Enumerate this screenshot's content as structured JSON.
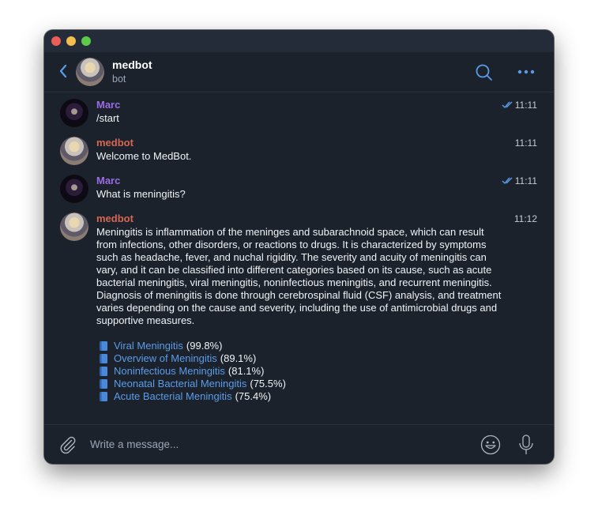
{
  "window": {
    "traffic_lights": [
      "close",
      "minimize",
      "zoom"
    ]
  },
  "header": {
    "title": "medbot",
    "subtitle": "bot",
    "icons": {
      "back": "chevron-left-icon",
      "search": "search-icon",
      "more": "more-dots-icon"
    }
  },
  "messages": [
    {
      "author": "Marc",
      "role": "user",
      "text": "/start",
      "time": "11:11",
      "read": true,
      "is_command": true
    },
    {
      "author": "medbot",
      "role": "bot",
      "text": "Welcome to MedBot.",
      "time": "11:11",
      "read": false
    },
    {
      "author": "Marc",
      "role": "user",
      "text": "What is meningitis?",
      "time": "11:11",
      "read": true
    },
    {
      "author": "medbot",
      "role": "bot",
      "time": "11:12",
      "read": false,
      "text": "Meningitis is inflammation of the meninges and subarachnoid space, which can result from infections, other disorders, or reactions to drugs. It is characterized by symptoms such as headache, fever, and nuchal rigidity. The severity and acuity of meningitis can vary, and it can be classified into different categories based on its cause, such as acute bacterial meningitis, viral meningitis, noninfectious meningitis, and recurrent meningitis. Diagnosis of meningitis is done through cerebrospinal fluid (CSF) analysis, and treatment varies depending on the cause and severity, including the use of antimicrobial drugs and supportive measures.",
      "links": [
        {
          "icon": "book-icon",
          "label": "Viral Meningitis",
          "score": "(99.8%)"
        },
        {
          "icon": "book-icon",
          "label": "Overview of Meningitis",
          "score": "(89.1%)"
        },
        {
          "icon": "book-icon",
          "label": "Noninfectious Meningitis",
          "score": "(81.1%)"
        },
        {
          "icon": "book-icon",
          "label": "Neonatal Bacterial Meningitis",
          "score": "(75.5%)"
        },
        {
          "icon": "book-icon",
          "label": "Acute Bacterial Meningitis",
          "score": "(75.4%)"
        }
      ]
    }
  ],
  "composer": {
    "placeholder": "Write a message...",
    "value": "",
    "icons": {
      "attach": "paperclip-icon",
      "emoji": "emoji-icon",
      "voice": "microphone-icon"
    }
  },
  "colors": {
    "background": "#1c222c",
    "titlebar": "#242c3a",
    "accent": "#5a9ce8",
    "user_name": "#9b6be3",
    "bot_name": "#d46652"
  }
}
